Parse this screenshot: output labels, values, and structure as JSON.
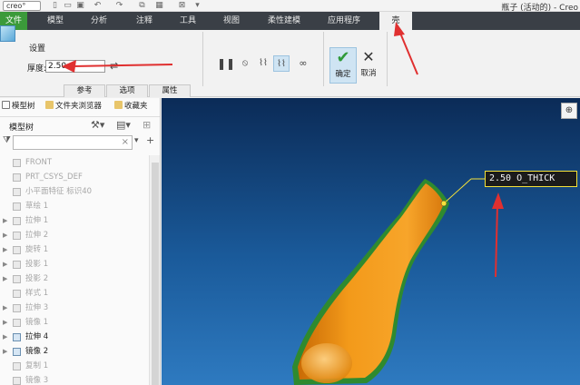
{
  "titlebar": {
    "logo": "creo°",
    "window_title": "瓶子 (活动的) - Creo"
  },
  "menubar": {
    "file": "文件",
    "items": [
      "模型",
      "分析",
      "注释",
      "工具",
      "视图",
      "柔性建模",
      "应用程序"
    ],
    "active_tab": "壳"
  },
  "ribbon": {
    "settings_label": "设置",
    "thickness_label": "厚度:",
    "thickness_value": "2.50",
    "subtabs": [
      "参考",
      "选项",
      "属性"
    ],
    "ok_label": "确定",
    "cancel_label": "取消"
  },
  "left_panel": {
    "tabs": [
      "模型树",
      "文件夹浏览器",
      "收藏夹"
    ],
    "tree_title": "模型树",
    "search_placeholder": "",
    "items": [
      {
        "label": "FRONT",
        "state": "dim",
        "expandable": false
      },
      {
        "label": "PRT_CSYS_DEF",
        "state": "dim",
        "expandable": false
      },
      {
        "label": "小平面特征 标识40",
        "state": "dim",
        "expandable": false
      },
      {
        "label": "草绘 1",
        "state": "dim",
        "expandable": false
      },
      {
        "label": "拉伸 1",
        "state": "dim",
        "expandable": true
      },
      {
        "label": "拉伸 2",
        "state": "dim",
        "expandable": true
      },
      {
        "label": "旋转 1",
        "state": "dim",
        "expandable": true
      },
      {
        "label": "投影 1",
        "state": "dim",
        "expandable": true
      },
      {
        "label": "投影 2",
        "state": "dim",
        "expandable": true
      },
      {
        "label": "样式 1",
        "state": "dim",
        "expandable": false
      },
      {
        "label": "拉伸 3",
        "state": "dim",
        "expandable": true
      },
      {
        "label": "镜像 1",
        "state": "dim",
        "expandable": true
      },
      {
        "label": "拉伸 4",
        "state": "bold",
        "expandable": true
      },
      {
        "label": "镜像 2",
        "state": "bold",
        "expandable": true
      },
      {
        "label": "复制 1",
        "state": "dim",
        "expandable": false
      },
      {
        "label": "镜像 3",
        "state": "dim",
        "expandable": false
      }
    ]
  },
  "viewport": {
    "dimension_label": "2.50 O_THICK"
  },
  "colors": {
    "file_tab": "#3b9a3a",
    "menubar": "#3a3f46",
    "viewport_top": "#0b2b57",
    "viewport_bottom": "#2e7ac0",
    "part_orange": "#f39a1a",
    "shell_green": "#2f8a2f",
    "annotation_red": "#e03030"
  }
}
